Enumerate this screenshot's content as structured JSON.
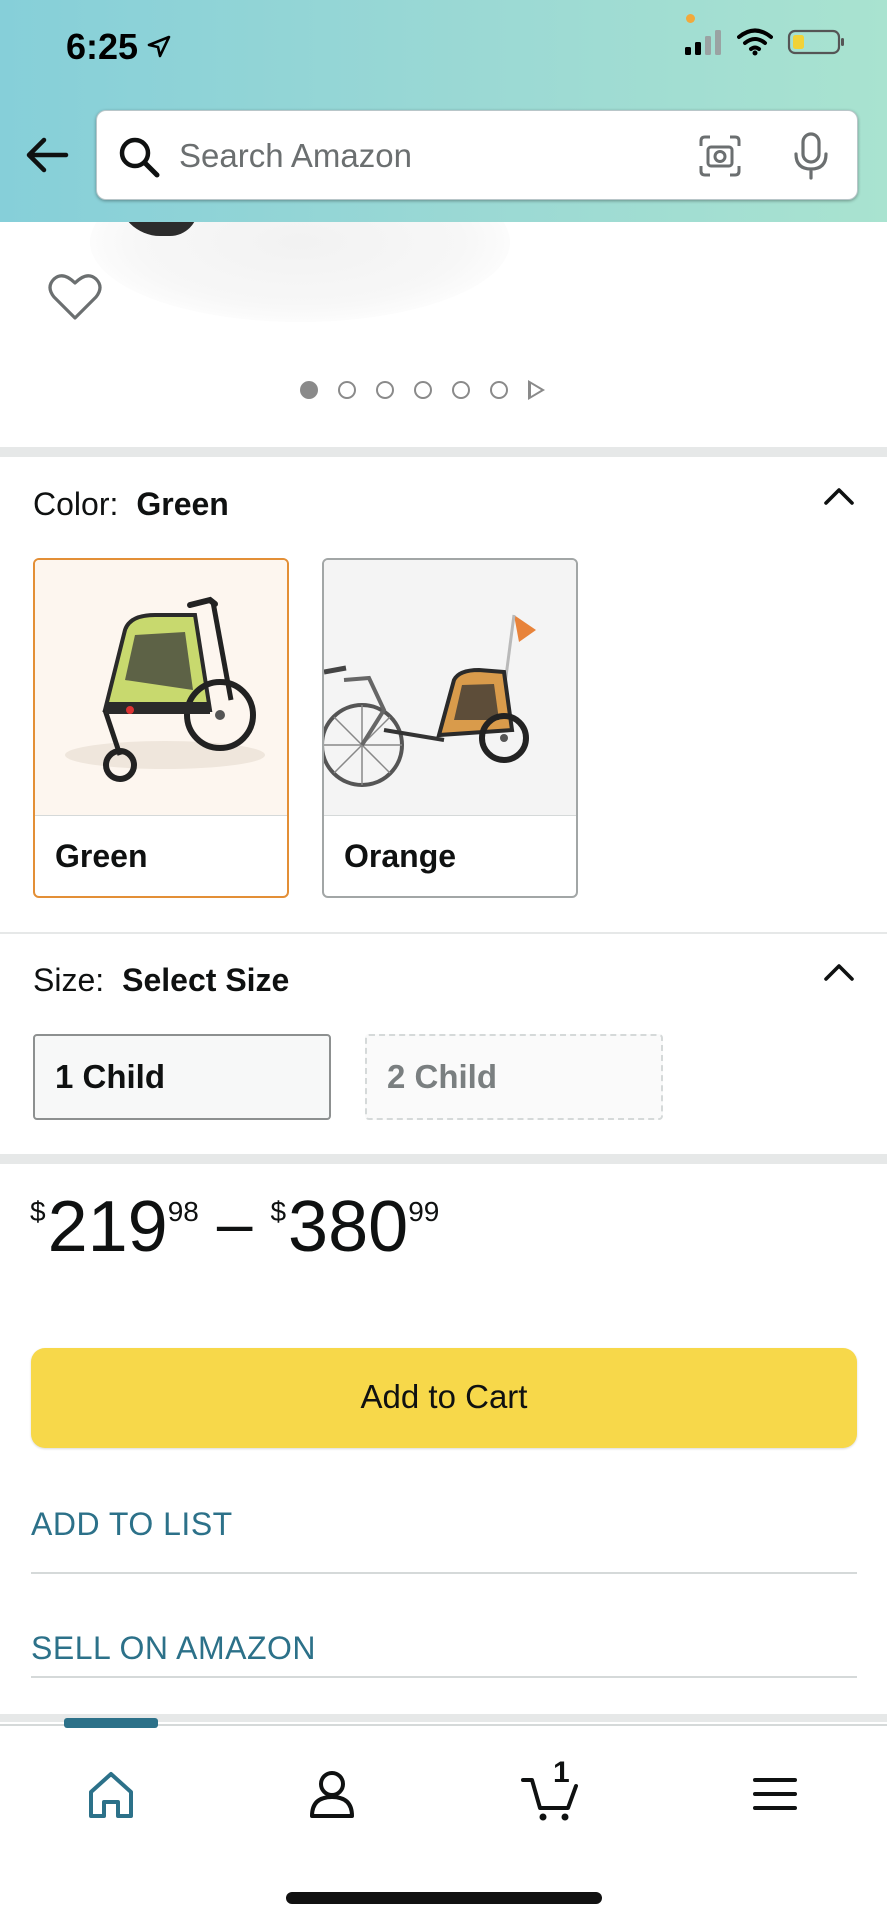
{
  "status": {
    "time": "6:25"
  },
  "search": {
    "placeholder": "Search Amazon"
  },
  "color_section": {
    "label": "Color:",
    "selected": "Green",
    "options": [
      {
        "name": "Green"
      },
      {
        "name": "Orange"
      }
    ]
  },
  "size_section": {
    "label": "Size:",
    "selected": "Select Size",
    "options": [
      {
        "name": "1 Child"
      },
      {
        "name": "2 Child"
      }
    ]
  },
  "price": {
    "low_symbol": "$",
    "low_whole": "219",
    "low_fraction": "98",
    "separator": "–",
    "high_symbol": "$",
    "high_whole": "380",
    "high_fraction": "99"
  },
  "actions": {
    "add_to_cart": "Add to Cart",
    "add_to_list": "ADD TO LIST",
    "sell_on_amazon": "SELL ON AMAZON"
  },
  "gallery": {
    "page_count": 6,
    "active_index": 0
  },
  "bottom_nav": {
    "items": [
      "home-icon",
      "account-icon",
      "cart-icon",
      "menu-icon"
    ],
    "cart_count": "1",
    "active_index": 0
  },
  "colors": {
    "header_gradient_start": "#86cfd9",
    "header_gradient_end": "#a9e3d0",
    "add_to_cart": "#f7d84a",
    "link": "#2c7189",
    "selected_swatch_border": "#e38f36"
  }
}
